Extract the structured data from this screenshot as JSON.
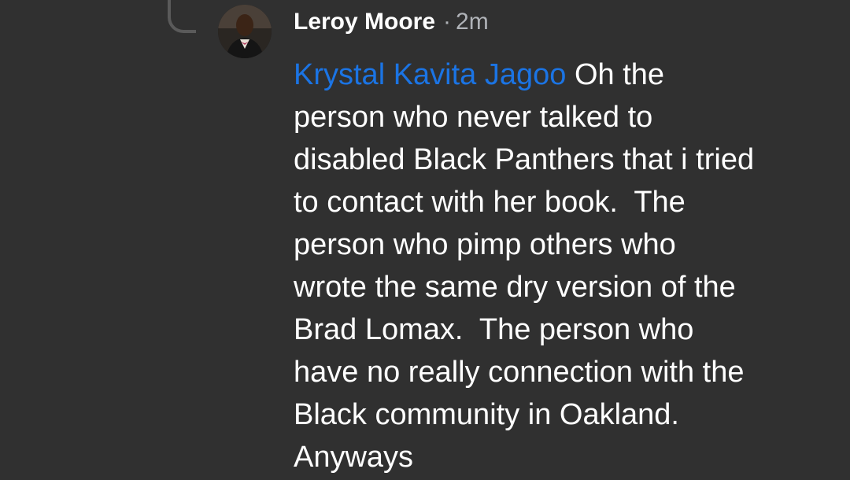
{
  "comment": {
    "author": "Leroy Moore",
    "separator": "·",
    "timestamp": "2m",
    "mention": "Krystal Kavita Jagoo",
    "text": " Oh the\nperson who never talked to\ndisabled Black Panthers that i tried\nto contact with her book.  The\nperson who pimp others who\nwrote the same dry version of the\nBrad Lomax.  The person who\nhave no really connection with the\nBlack community in Oakland.\nAnyways"
  },
  "colors": {
    "background": "#303030",
    "text": "#ffffff",
    "mention": "#1b74e4",
    "muted": "#b0b3b8",
    "thread_line": "#5a5a5a"
  }
}
